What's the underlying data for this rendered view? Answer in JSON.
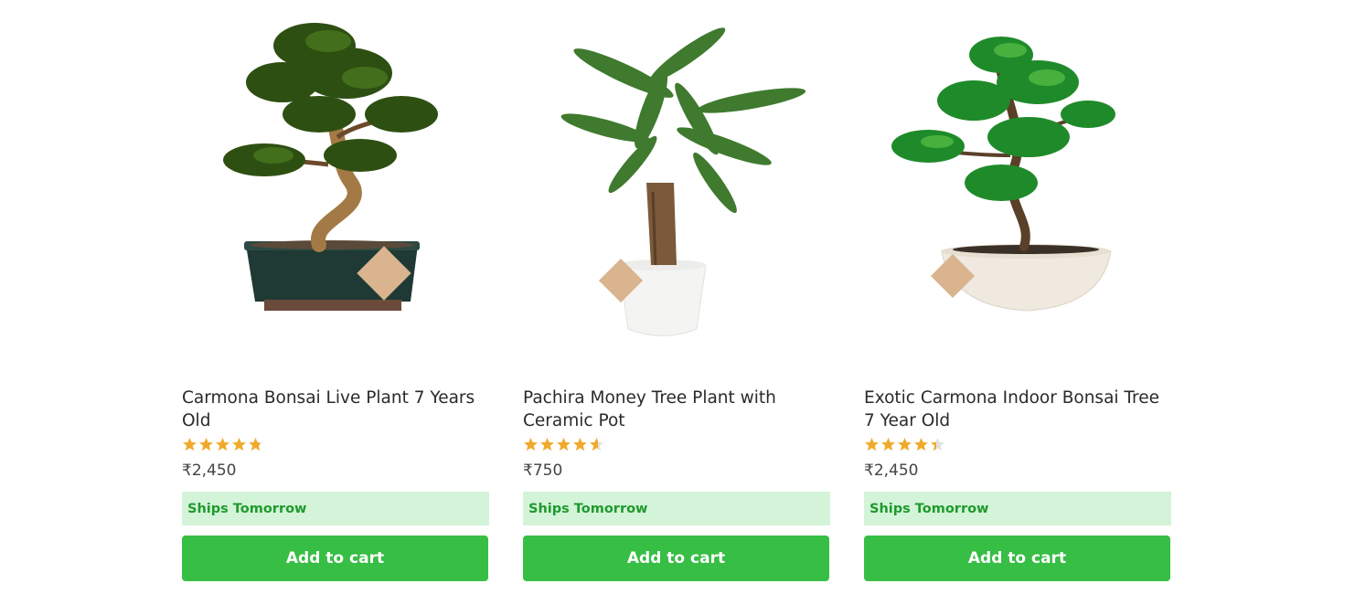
{
  "products": [
    {
      "title": "Carmona Bonsai Live Plant 7 Years Old",
      "rating": 4.8,
      "price": "₹2,450",
      "ships": "Ships Tomorrow",
      "cta": "Add to cart",
      "image_icon": "carmona-bonsai-image"
    },
    {
      "title": "Pachira Money Tree Plant with Ceramic Pot",
      "rating": 4.6,
      "price": "₹750",
      "ships": "Ships Tomorrow",
      "cta": "Add to cart",
      "image_icon": "money-tree-image"
    },
    {
      "title": "Exotic Carmona Indoor Bonsai Tree 7 Year Old",
      "rating": 4.4,
      "price": "₹2,450",
      "ships": "Ships Tomorrow",
      "cta": "Add to cart",
      "image_icon": "exotic-bonsai-image"
    }
  ],
  "colors": {
    "accent": "#37be45",
    "ships_bg": "#d3f4d8",
    "ships_text": "#1f9a2e",
    "star": "#f0a92b",
    "star_empty": "#e0e0e0"
  }
}
